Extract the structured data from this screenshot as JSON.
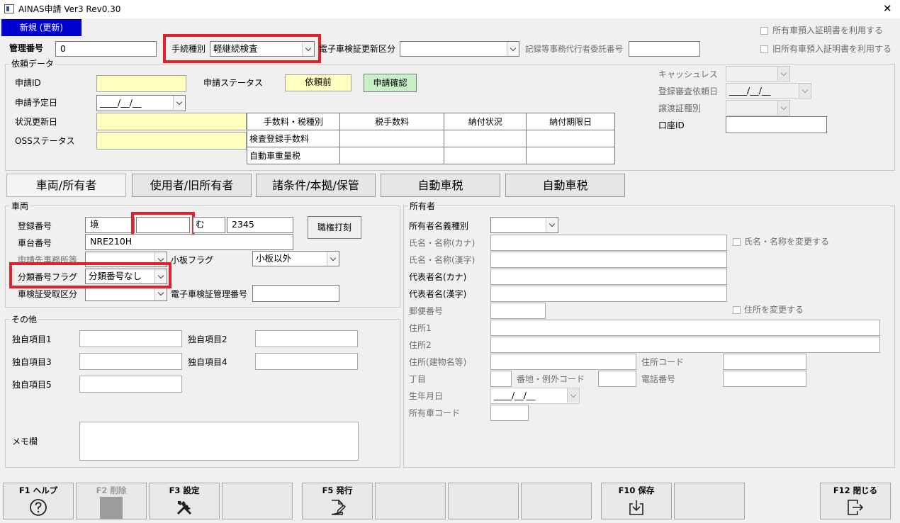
{
  "window": {
    "title": "AINAS申請 Ver3 Rev0.30",
    "close": "✕"
  },
  "mode_badge": "新規 (更新)",
  "header": {
    "kanri_label": "管理番号",
    "kanri_value": "0",
    "tetsuzuki_label": "手続種別",
    "tetsuzuki_value": "軽継続検査",
    "denshi_koshin_label": "電子車検証更新区分",
    "denshi_koshin_value": "",
    "kiroku_label": "記録等事務代行者委託番号",
    "kiroku_value": "",
    "chk_shoyusha": "所有車預入証明書を利用する",
    "chk_kyu_shoyusha": "旧所有車預入証明書を利用する"
  },
  "irai": {
    "group_title": "依頼データ",
    "shinsei_id_label": "申請ID",
    "shinsei_id_value": "",
    "status_label": "申請ステータス",
    "status_value": "依頼前",
    "confirm_button": "申請確認",
    "yotei_label": "申請予定日",
    "yotei_value": "____/__/__",
    "jokyo_label": "状況更新日",
    "jokyo_value": "",
    "oss_label": "OSSステータス",
    "oss_value": "",
    "fee_table": {
      "headers": [
        "手数料・税種別",
        "税手数料",
        "納付状況",
        "納付期限日"
      ],
      "rows": [
        [
          "検査登録手数料",
          "",
          "",
          ""
        ],
        [
          "自動車重量税",
          "",
          "",
          ""
        ]
      ]
    },
    "cashless_label": "キャッシュレス",
    "cashless_value": "",
    "tourokushinsa_label": "登録審査依頼日",
    "tourokushinsa_value": "____/__/__",
    "jouto_label": "譲渡証種別",
    "jouto_value": "",
    "koza_label": "口座ID",
    "koza_value": ""
  },
  "tabs": [
    "車両/所有者",
    "使用者/旧所有者",
    "諸条件/本拠/保管",
    "自動車税",
    "自動車税"
  ],
  "sharyo": {
    "group_title": "車両",
    "touroku_label": "登録番号",
    "touroku_values": [
      "境",
      "",
      "む",
      "2345"
    ],
    "shokken_button": "職権打刻",
    "shadai_label": "車台番号",
    "shadai_value": "NRE210H",
    "jimusho_label": "申請先事務所等",
    "jimusho_value": "",
    "koban_label": "小板フラグ",
    "koban_value": "小板以外",
    "bunrui_label": "分類番号フラグ",
    "bunrui_value": "分類番号なし",
    "shakensho_label": "車検証受取区分",
    "shakensho_value": "",
    "denshi_kanri_label": "電子車検証管理番号",
    "denshi_kanri_value": ""
  },
  "sonota": {
    "group_title": "その他",
    "items": [
      "独自項目1",
      "独自項目2",
      "独自項目3",
      "独自項目4",
      "独自項目5"
    ],
    "memo_label": "メモ欄"
  },
  "shoyusha": {
    "group_title": "所有者",
    "meigi_label": "所有者名義種別",
    "kana_label": "氏名・名称(カナ)",
    "kanji_label": "氏名・名称(漢字)",
    "chk_name": "氏名・名称を変更する",
    "daihyo_kana_label": "代表者名(カナ)",
    "daihyo_kanji_label": "代表者名(漢字)",
    "yubin_label": "郵便番号",
    "chk_address": "住所を変更する",
    "jusho1_label": "住所1",
    "jusho2_label": "住所2",
    "jusho3_label": "住所(建物名等)",
    "jusho_code_label": "住所コード",
    "chome_label": "丁目",
    "banchi_label": "番地・例外コード",
    "tel_label": "電話番号",
    "birth_label": "生年月日",
    "birth_value": "____/__/__",
    "shoyusha_code_label": "所有車コード"
  },
  "fkeys": [
    "F1 ヘルプ",
    "F2 削除",
    "F3 設定",
    "",
    "F5 発行",
    "",
    "",
    "",
    "F10 保存",
    "",
    "F12 閉じる"
  ]
}
